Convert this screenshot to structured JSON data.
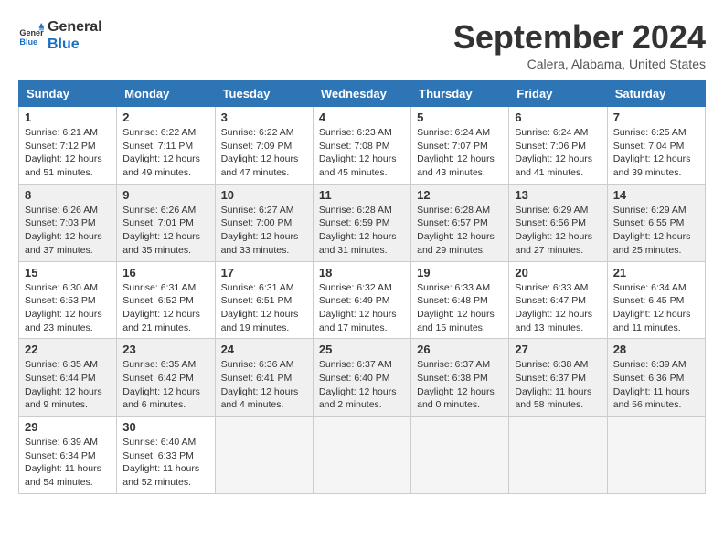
{
  "logo": {
    "line1": "General",
    "line2": "Blue"
  },
  "title": "September 2024",
  "location": "Calera, Alabama, United States",
  "columns": [
    "Sunday",
    "Monday",
    "Tuesday",
    "Wednesday",
    "Thursday",
    "Friday",
    "Saturday"
  ],
  "weeks": [
    [
      {
        "day": "1",
        "info": "Sunrise: 6:21 AM\nSunset: 7:12 PM\nDaylight: 12 hours\nand 51 minutes."
      },
      {
        "day": "2",
        "info": "Sunrise: 6:22 AM\nSunset: 7:11 PM\nDaylight: 12 hours\nand 49 minutes."
      },
      {
        "day": "3",
        "info": "Sunrise: 6:22 AM\nSunset: 7:09 PM\nDaylight: 12 hours\nand 47 minutes."
      },
      {
        "day": "4",
        "info": "Sunrise: 6:23 AM\nSunset: 7:08 PM\nDaylight: 12 hours\nand 45 minutes."
      },
      {
        "day": "5",
        "info": "Sunrise: 6:24 AM\nSunset: 7:07 PM\nDaylight: 12 hours\nand 43 minutes."
      },
      {
        "day": "6",
        "info": "Sunrise: 6:24 AM\nSunset: 7:06 PM\nDaylight: 12 hours\nand 41 minutes."
      },
      {
        "day": "7",
        "info": "Sunrise: 6:25 AM\nSunset: 7:04 PM\nDaylight: 12 hours\nand 39 minutes."
      }
    ],
    [
      {
        "day": "8",
        "info": "Sunrise: 6:26 AM\nSunset: 7:03 PM\nDaylight: 12 hours\nand 37 minutes."
      },
      {
        "day": "9",
        "info": "Sunrise: 6:26 AM\nSunset: 7:01 PM\nDaylight: 12 hours\nand 35 minutes."
      },
      {
        "day": "10",
        "info": "Sunrise: 6:27 AM\nSunset: 7:00 PM\nDaylight: 12 hours\nand 33 minutes."
      },
      {
        "day": "11",
        "info": "Sunrise: 6:28 AM\nSunset: 6:59 PM\nDaylight: 12 hours\nand 31 minutes."
      },
      {
        "day": "12",
        "info": "Sunrise: 6:28 AM\nSunset: 6:57 PM\nDaylight: 12 hours\nand 29 minutes."
      },
      {
        "day": "13",
        "info": "Sunrise: 6:29 AM\nSunset: 6:56 PM\nDaylight: 12 hours\nand 27 minutes."
      },
      {
        "day": "14",
        "info": "Sunrise: 6:29 AM\nSunset: 6:55 PM\nDaylight: 12 hours\nand 25 minutes."
      }
    ],
    [
      {
        "day": "15",
        "info": "Sunrise: 6:30 AM\nSunset: 6:53 PM\nDaylight: 12 hours\nand 23 minutes."
      },
      {
        "day": "16",
        "info": "Sunrise: 6:31 AM\nSunset: 6:52 PM\nDaylight: 12 hours\nand 21 minutes."
      },
      {
        "day": "17",
        "info": "Sunrise: 6:31 AM\nSunset: 6:51 PM\nDaylight: 12 hours\nand 19 minutes."
      },
      {
        "day": "18",
        "info": "Sunrise: 6:32 AM\nSunset: 6:49 PM\nDaylight: 12 hours\nand 17 minutes."
      },
      {
        "day": "19",
        "info": "Sunrise: 6:33 AM\nSunset: 6:48 PM\nDaylight: 12 hours\nand 15 minutes."
      },
      {
        "day": "20",
        "info": "Sunrise: 6:33 AM\nSunset: 6:47 PM\nDaylight: 12 hours\nand 13 minutes."
      },
      {
        "day": "21",
        "info": "Sunrise: 6:34 AM\nSunset: 6:45 PM\nDaylight: 12 hours\nand 11 minutes."
      }
    ],
    [
      {
        "day": "22",
        "info": "Sunrise: 6:35 AM\nSunset: 6:44 PM\nDaylight: 12 hours\nand 9 minutes."
      },
      {
        "day": "23",
        "info": "Sunrise: 6:35 AM\nSunset: 6:42 PM\nDaylight: 12 hours\nand 6 minutes."
      },
      {
        "day": "24",
        "info": "Sunrise: 6:36 AM\nSunset: 6:41 PM\nDaylight: 12 hours\nand 4 minutes."
      },
      {
        "day": "25",
        "info": "Sunrise: 6:37 AM\nSunset: 6:40 PM\nDaylight: 12 hours\nand 2 minutes."
      },
      {
        "day": "26",
        "info": "Sunrise: 6:37 AM\nSunset: 6:38 PM\nDaylight: 12 hours\nand 0 minutes."
      },
      {
        "day": "27",
        "info": "Sunrise: 6:38 AM\nSunset: 6:37 PM\nDaylight: 11 hours\nand 58 minutes."
      },
      {
        "day": "28",
        "info": "Sunrise: 6:39 AM\nSunset: 6:36 PM\nDaylight: 11 hours\nand 56 minutes."
      }
    ],
    [
      {
        "day": "29",
        "info": "Sunrise: 6:39 AM\nSunset: 6:34 PM\nDaylight: 11 hours\nand 54 minutes."
      },
      {
        "day": "30",
        "info": "Sunrise: 6:40 AM\nSunset: 6:33 PM\nDaylight: 11 hours\nand 52 minutes."
      },
      {
        "day": "",
        "info": ""
      },
      {
        "day": "",
        "info": ""
      },
      {
        "day": "",
        "info": ""
      },
      {
        "day": "",
        "info": ""
      },
      {
        "day": "",
        "info": ""
      }
    ]
  ]
}
